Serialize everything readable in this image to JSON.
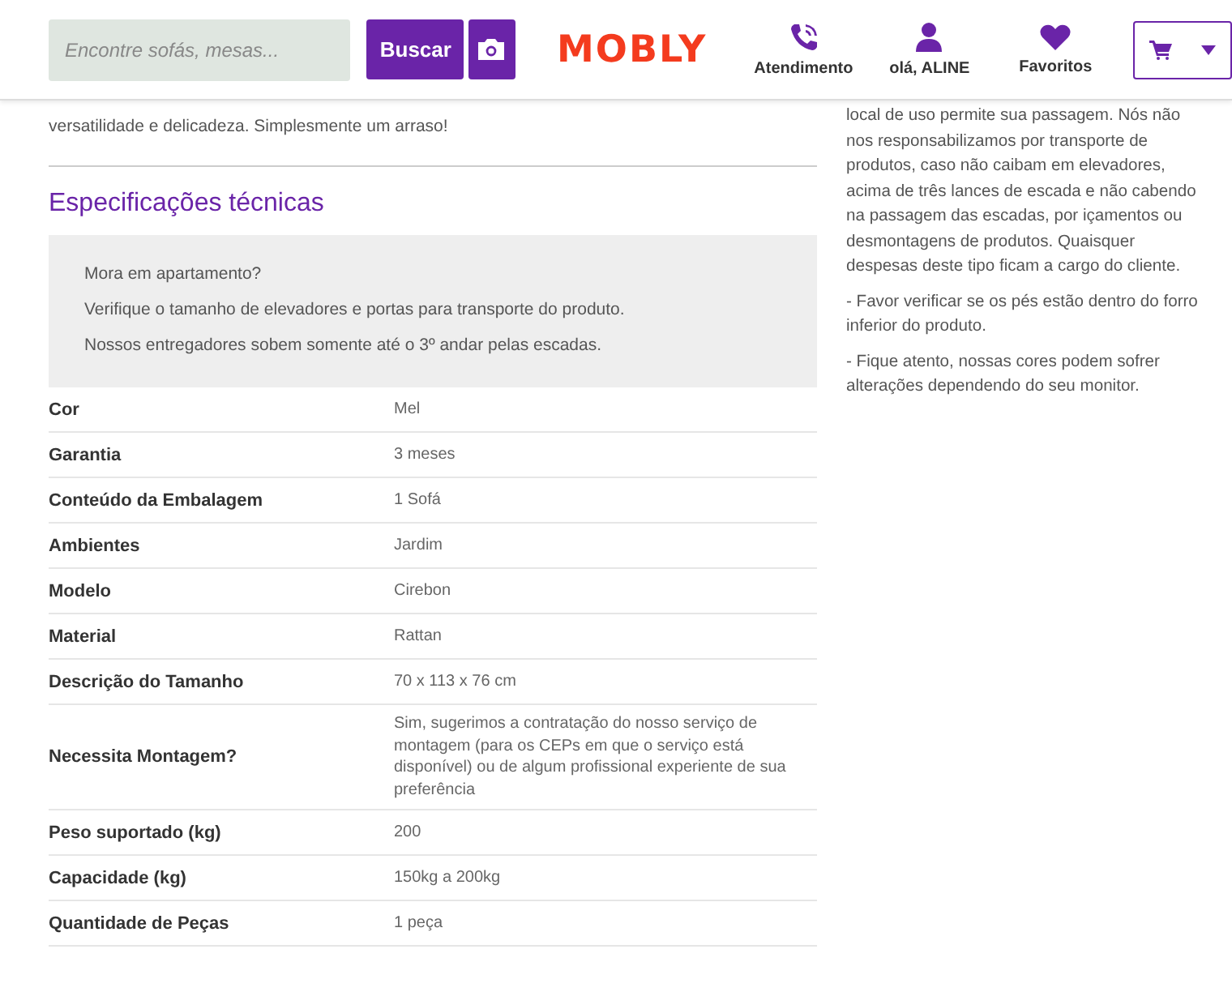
{
  "header": {
    "search": {
      "placeholder": "Encontre sofás, mesas..."
    },
    "search_button": "Buscar",
    "logo": "MOBLY",
    "nav": [
      {
        "kind": "phone",
        "label": "Atendimento"
      },
      {
        "kind": "user",
        "label": "olá, ALINE"
      },
      {
        "kind": "heart",
        "label": "Favoritos"
      }
    ]
  },
  "intro": "versatilidade e delicadeza. Simplesmente um arraso!",
  "specs": {
    "title": "Especificações técnicas",
    "notice": [
      "Mora em apartamento?",
      "Verifique o tamanho de elevadores e portas para transporte do produto.",
      "Nossos entregadores sobem somente até o 3º andar pelas escadas."
    ],
    "rows": [
      {
        "label": "Cor",
        "value": "Mel"
      },
      {
        "label": "Garantia",
        "value": "3 meses"
      },
      {
        "label": "Conteúdo da Embalagem",
        "value": "1 Sofá"
      },
      {
        "label": "Ambientes",
        "value": "Jardim"
      },
      {
        "label": "Modelo",
        "value": "Cirebon"
      },
      {
        "label": "Material",
        "value": "Rattan"
      },
      {
        "label": "Descrição do Tamanho",
        "value": "70 x 113 x 76 cm"
      },
      {
        "label": "Necessita Montagem?",
        "value": "Sim, sugerimos a contratação do nosso serviço de montagem (para os CEPs em que o serviço está disponível) ou de algum profissional experiente de sua preferência"
      },
      {
        "label": "Peso suportado (kg)",
        "value": "200"
      },
      {
        "label": "Capacidade (kg)",
        "value": "150kg a 200kg"
      },
      {
        "label": "Quantidade de Peças",
        "value": "1 peça"
      }
    ]
  },
  "side_notes": [
    "local de uso permite sua passagem. Nós não nos responsabilizamos por transporte de produtos, caso não caibam em elevadores, acima de três lances de escada e não cabendo na passagem das escadas, por içamentos ou desmontagens de produtos. Quaisquer despesas deste tipo ficam a cargo do cliente.",
    "- Favor verificar se os pés estão dentro do forro inferior do produto.",
    "- Fique atento, nossas cores podem sofrer alterações dependendo do seu monitor."
  ]
}
